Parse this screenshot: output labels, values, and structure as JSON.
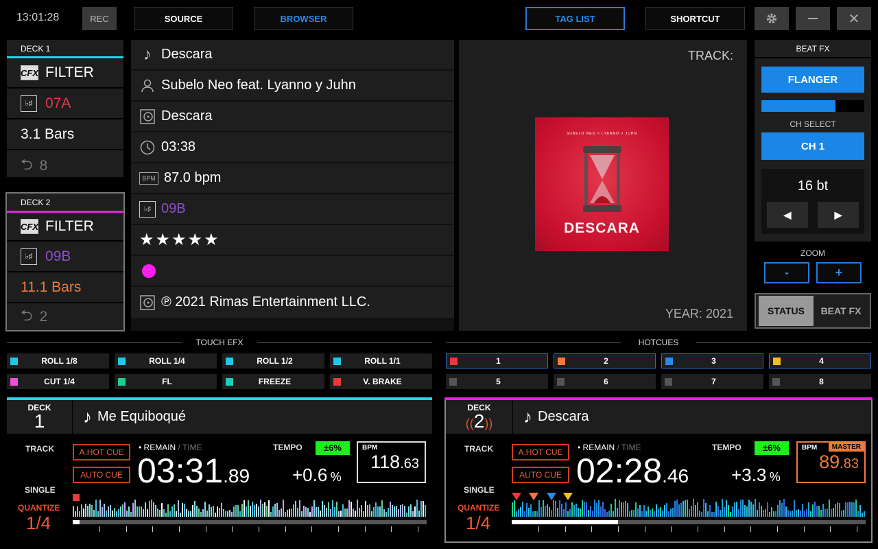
{
  "topbar": {
    "clock": "13:01:28",
    "rec": "REC",
    "source": "SOURCE",
    "browser": "BROWSER",
    "tag_list": "TAG LIST",
    "shortcut": "SHORTCUT"
  },
  "deck1_info": {
    "label": "DECK 1",
    "fx": "FILTER",
    "key": "07A",
    "bars": "3.1 Bars",
    "loop": "8",
    "accent": "#24d4ea",
    "key_color": "#e03a4a"
  },
  "deck2_info": {
    "label": "DECK 2",
    "fx": "FILTER",
    "key": "09B",
    "bars": "11.1 Bars",
    "loop": "2",
    "accent": "#e81fe0",
    "key_color": "#8a4fc8",
    "bars_color": "#f07a3a"
  },
  "track_info": {
    "title": "Descara",
    "artist": "Subelo Neo feat. Lyanno y Juhn",
    "album": "Descara",
    "time": "03:38",
    "bpm": "87.0 bpm",
    "key": "09B",
    "rating": "★★★★★",
    "copyright": "℗ 2021 Rimas Entertainment LLC."
  },
  "artwork": {
    "track_label": "TRACK:",
    "art_top": "SUBELO NEO × LYANNO × JUHN",
    "art_title": "DESCARA",
    "year_label": "YEAR:",
    "year": "2021"
  },
  "beatfx": {
    "title": "BEAT FX",
    "effect": "FLANGER",
    "level": 0.72,
    "ch_select_label": "CH SELECT",
    "ch": "CH 1",
    "beat": "16 bt",
    "prev": "◀",
    "next": "▶",
    "zoom_label": "ZOOM",
    "zoom_minus": "-",
    "zoom_plus": "+",
    "tab_status": "STATUS",
    "tab_beatfx": "BEAT FX"
  },
  "touch_efx": {
    "title": "TOUCH EFX",
    "pads": [
      {
        "label": "ROLL 1/8",
        "color": "#1ec8e8"
      },
      {
        "label": "ROLL 1/4",
        "color": "#1ec8e8"
      },
      {
        "label": "ROLL 1/2",
        "color": "#1ec8e8"
      },
      {
        "label": "ROLL 1/1",
        "color": "#1ec8e8"
      },
      {
        "label": "CUT 1/4",
        "color": "#f050d8"
      },
      {
        "label": "FL",
        "color": "#1ed08a"
      },
      {
        "label": "FREEZE",
        "color": "#1ed0b8"
      },
      {
        "label": "V. BRAKE",
        "color": "#e83a3a"
      }
    ]
  },
  "hotcues": {
    "title": "HOTCUES",
    "pads": [
      {
        "label": "1",
        "color": "#e83a3a"
      },
      {
        "label": "2",
        "color": "#f07a3a"
      },
      {
        "label": "3",
        "color": "#2a8ae8"
      },
      {
        "label": "4",
        "color": "#f0c020"
      },
      {
        "label": "5",
        "color": "#555555"
      },
      {
        "label": "6",
        "color": "#555555"
      },
      {
        "label": "7",
        "color": "#555555"
      },
      {
        "label": "8",
        "color": "#555555"
      }
    ]
  },
  "deck_a": {
    "deck_label": "DECK",
    "deck_num": "1",
    "title": "Me Equiboqué",
    "track_mode": "TRACK",
    "single": "SINGLE",
    "quantize": "QUANTIZE",
    "quantize_val": "1/4",
    "hot_cue_btn": "A.HOT CUE",
    "auto_cue_btn": "AUTO CUE",
    "remain": "• REMAIN",
    "time": " / TIME",
    "time_main": "03:31",
    "time_frac": ".89",
    "tempo_label": "TEMPO",
    "tempo_range": "±6%",
    "tempo_val": "+0.6",
    "tempo_unit": "%",
    "bpm_label": "BPM",
    "bpm_main": "118",
    "bpm_frac": ".63",
    "progress": 0.02
  },
  "deck_b": {
    "deck_label": "DECK",
    "deck_num": "2",
    "title": "Descara",
    "track_mode": "TRACK",
    "single": "SINGLE",
    "quantize": "QUANTIZE",
    "quantize_val": "1/4",
    "hot_cue_btn": "A.HOT CUE",
    "auto_cue_btn": "AUTO CUE",
    "remain": "• REMAIN",
    "time": " / TIME",
    "time_main": "02:28",
    "time_frac": ".46",
    "tempo_label": "TEMPO",
    "tempo_range": "±6%",
    "tempo_val": "+3.3",
    "tempo_unit": "%",
    "bpm_label": "BPM",
    "master": "MASTER",
    "bpm_main": "89",
    "bpm_frac": ".83",
    "progress": 0.3
  }
}
